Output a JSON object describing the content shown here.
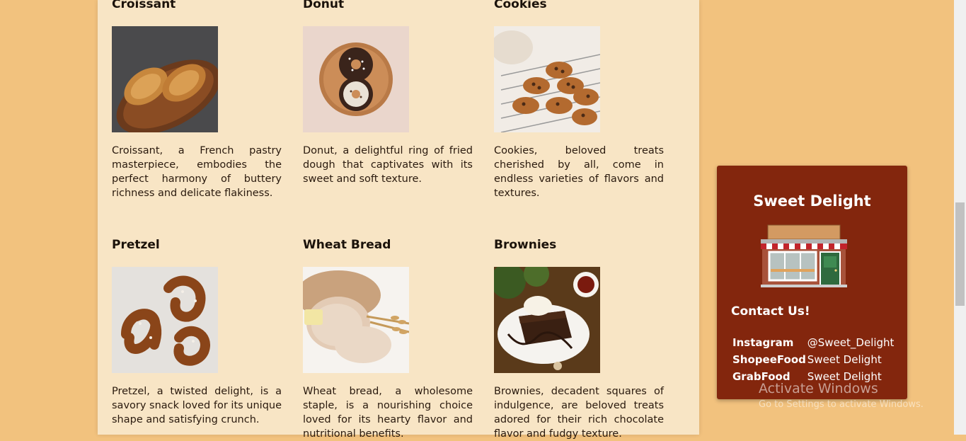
{
  "products": [
    {
      "name": "Croissant",
      "description": "Croissant, a French pastry masterpiece, embodies the perfect harmony of buttery richness and delicate flakiness."
    },
    {
      "name": "Donut",
      "description": "Donut, a delightful ring of fried dough that captivates with its sweet and soft texture."
    },
    {
      "name": "Cookies",
      "description": "Cookies, beloved treats cherished by all, come in endless varieties of flavors and textures."
    },
    {
      "name": "Pretzel",
      "description": "Pretzel, a twisted delight, is a savory snack loved for its unique shape and satisfying crunch."
    },
    {
      "name": "Wheat Bread",
      "description": "Wheat bread, a wholesome staple, is a nourishing choice loved for its hearty flavor and nutritional benefits."
    },
    {
      "name": "Brownies",
      "description": "Brownies, decadent squares of indulgence, are beloved treats adored for their rich chocolate flavor and fudgy texture."
    }
  ],
  "contact": {
    "shop_name": "Sweet Delight",
    "heading": "Contact Us!",
    "rows": [
      {
        "label": "Instagram",
        "value": "@Sweet_Delight"
      },
      {
        "label": "ShopeeFood",
        "value": "Sweet Delight"
      },
      {
        "label": "GrabFood",
        "value": "Sweet Delight"
      }
    ]
  },
  "watermark": {
    "line1": "Activate Windows",
    "line2": "Go to Settings to activate Windows."
  },
  "colors": {
    "page_background": "#f2c27e",
    "panel_background": "#f8e5c5",
    "contact_background": "#83260d"
  },
  "icons": [
    "croissant-image",
    "donut-image",
    "cookies-image",
    "pretzel-image",
    "wheat-bread-image",
    "brownies-image",
    "bakery-shop-icon"
  ]
}
